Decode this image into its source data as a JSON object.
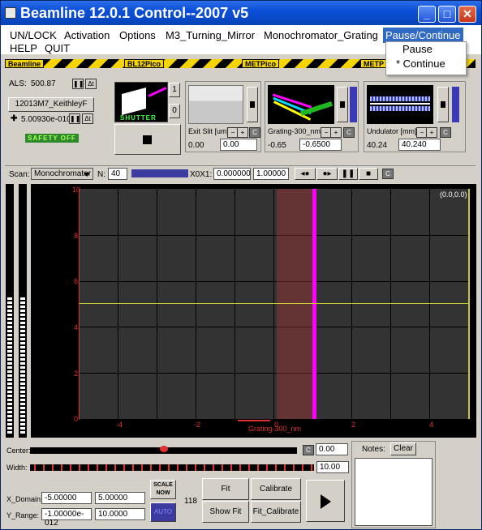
{
  "window": {
    "title": "Beamline 12.0.1 Control--2007 v5",
    "colors": {
      "titlebar": "#0b4fd8",
      "hazard_yellow": "#f5d400",
      "plot_bg": "#333333",
      "magenta": "#ff00ff",
      "tick_red": "#e03030"
    }
  },
  "menu": {
    "row1": [
      "UN/LOCK",
      "Activation",
      "Options",
      "M3_Turning_Mirror",
      "Monochromator_Grating",
      "Pause/Continue"
    ],
    "row2": [
      "HELP",
      "QUIT"
    ],
    "dropdown": [
      "Pause",
      "* Continue"
    ]
  },
  "hazard_labels": [
    "Beamline",
    "BL12Pico",
    "METPico",
    "METP"
  ],
  "left_panel": {
    "als_label": "ALS:",
    "als_value": "500.87",
    "device_button": "12013M7_KeithleyF",
    "current_value": "5.00930e-010",
    "safety": "SAFETY OFF"
  },
  "shutter": {
    "label": "SHUTTER",
    "btn1": "1",
    "btn0": "0"
  },
  "exit_slit": {
    "label": "Exit Slit [um]",
    "read": "0.00",
    "set": "0.00"
  },
  "grating": {
    "label": "Grating-300_nm",
    "read": "-0.65",
    "set": "-0.6500"
  },
  "undulator": {
    "label": "Undulator [mm]",
    "read": "40.24",
    "set": "40.240"
  },
  "scanbar": {
    "scan_label": "Scan:",
    "scan_mode": "Monochromator",
    "n_label": "N:",
    "n_value": "40",
    "x_label": "X0X1:",
    "x0": "0.000000",
    "x1": "1.00000",
    "c_label": "C"
  },
  "plot": {
    "corner_label": "(0.0,0.0)",
    "xlabel": "Grating-300_nm",
    "yticks": [
      "10",
      "8",
      "6",
      "4",
      "2",
      "0"
    ],
    "xticks": [
      "-4",
      "-2",
      "0",
      "2",
      "4"
    ]
  },
  "bottom": {
    "center_label": "Center:",
    "center_value": "0.00",
    "width_label": "Width:",
    "width_value": "10.00",
    "notes_label": "Notes:",
    "clear": "Clear",
    "xdomain_label": "X_Domain:",
    "xdomain_min": "-5.00000",
    "xdomain_max": "5.00000",
    "yrange_label": "Y_Range:",
    "yrange_min": "-1.00000e-012",
    "yrange_max": "10.0000",
    "scale_now": "SCALE NOW",
    "auto": "AUTO",
    "count": "118",
    "fit": "Fit",
    "calibrate": "Calibrate",
    "show_fit": "Show Fit",
    "fit_calibrate": "Fit_Calibrate"
  }
}
